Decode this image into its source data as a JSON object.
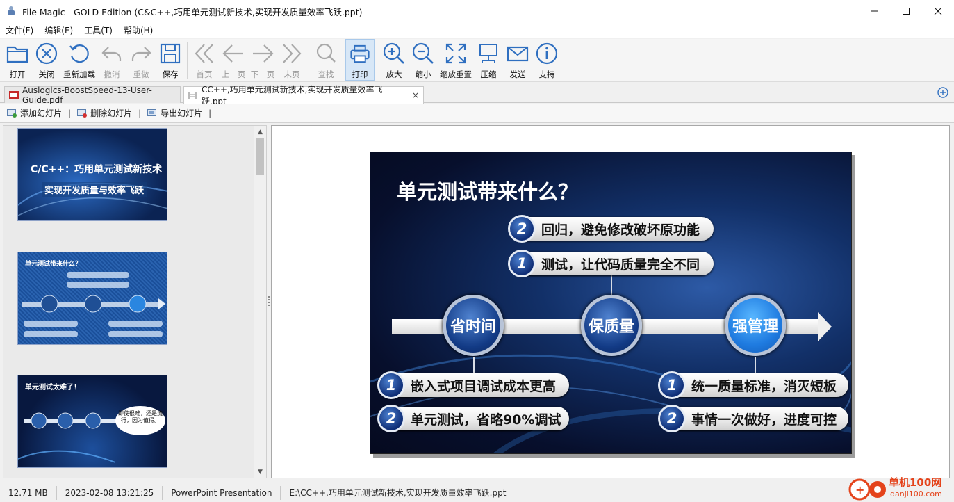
{
  "window": {
    "title": "File Magic - GOLD Edition (C&C++,巧用单元测试新技术,实现开发质量效率飞跃.ppt)"
  },
  "menu": [
    "文件(F)",
    "编辑(E)",
    "工具(T)",
    "帮助(H)"
  ],
  "toolbar": {
    "open": "打开",
    "close": "关闭",
    "reload": "重新加载",
    "undo": "撤消",
    "redo": "重做",
    "save": "保存",
    "first": "首页",
    "prev": "上一页",
    "next": "下一页",
    "last": "末页",
    "find": "查找",
    "print": "打印",
    "zoom_in": "放大",
    "zoom_out": "缩小",
    "zoom_reset": "缩放重置",
    "compress": "压缩",
    "send": "发送",
    "support": "支持"
  },
  "tabs": [
    {
      "label": "Auslogics-BoostSpeed-13-User-Guide.pdf"
    },
    {
      "label": "CC++,巧用单元测试新技术,实现开发质量效率飞跃.ppt",
      "close": "×"
    }
  ],
  "slidebar": {
    "add": "添加幻灯片",
    "delete": "删除幻灯片",
    "export": "导出幻灯片",
    "sep": "|"
  },
  "thumbnails": [
    {
      "line1": "C/C++：巧用单元测试新技术",
      "line2": "实现开发质量与效率飞跃"
    },
    {
      "title": "单元测试带来什么？"
    },
    {
      "title": "单元测试太难了！",
      "bubble": "即使很难，还是流行，因为值得。"
    }
  ],
  "slide": {
    "title": "单元测试带来什么？",
    "top_items": [
      {
        "num": "2",
        "text": "回归，避免修改破坏原功能"
      },
      {
        "num": "1",
        "text": "测试，让代码质量完全不同"
      }
    ],
    "bubbles": [
      "省时间",
      "保质量",
      "强管理"
    ],
    "left_items": [
      {
        "num": "1",
        "text": "嵌入式项目调试成本更高"
      },
      {
        "num": "2",
        "text": "单元测试，省略90%调试"
      }
    ],
    "right_items": [
      {
        "num": "1",
        "text": "统一质量标准，消灭短板"
      },
      {
        "num": "2",
        "text": "事情一次做好，进度可控"
      }
    ]
  },
  "status": {
    "size": "12.71 MB",
    "date": "2023-02-08 13:21:25",
    "type": "PowerPoint Presentation",
    "path": "E:\\CC++,巧用单元测试新技术,实现开发质量效率飞跃.ppt"
  },
  "watermark": {
    "name": "单机100网",
    "url": "danji100.com"
  },
  "colors": {
    "accent": "#2f6fc0",
    "icon_blue": "#2f6fc0",
    "disabled": "#a9a9a9",
    "slide_bg": "#0a1a45"
  }
}
